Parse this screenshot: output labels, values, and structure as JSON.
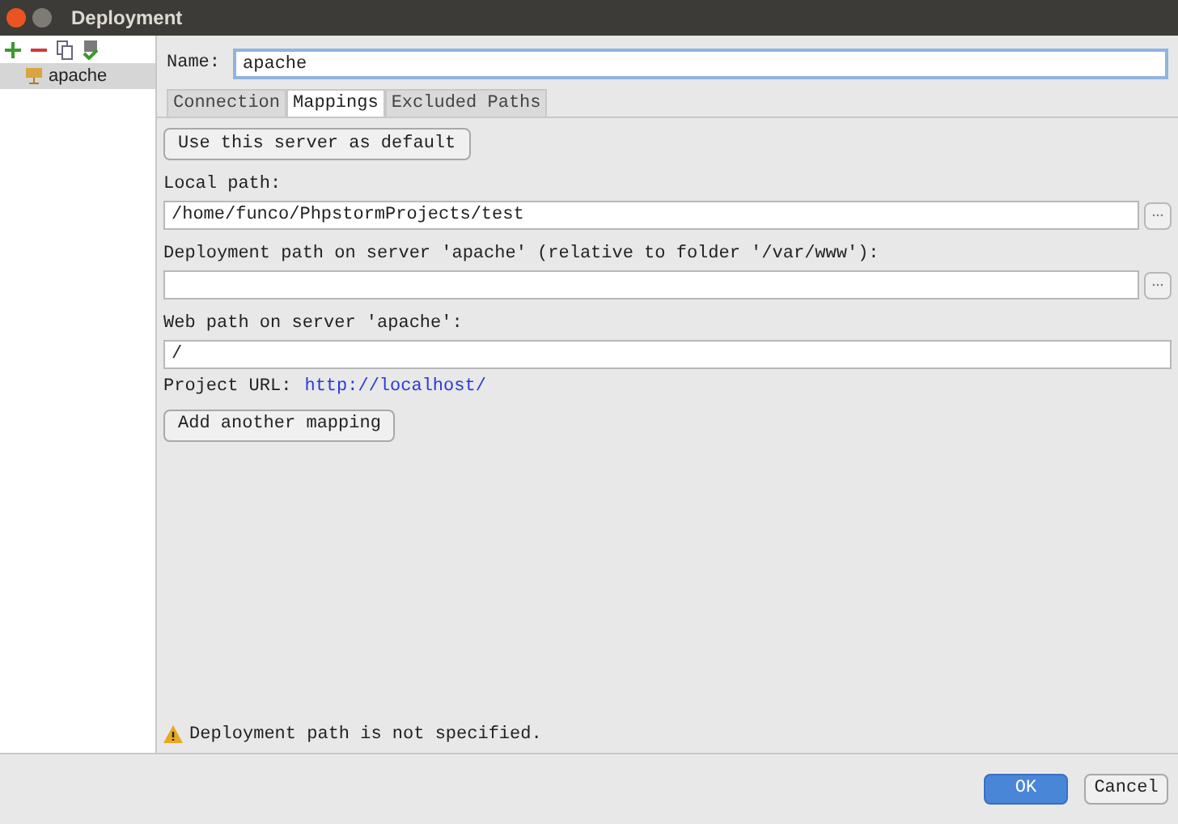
{
  "window": {
    "title": "Deployment"
  },
  "toolbar": {
    "buttons": [
      {
        "kind": "add"
      },
      {
        "kind": "remove"
      },
      {
        "kind": "copy"
      },
      {
        "kind": "default"
      }
    ]
  },
  "sidebar": {
    "items": [
      {
        "label": "apache",
        "selected": true
      }
    ]
  },
  "name_field": {
    "label": "Name:",
    "value": "apache"
  },
  "tabs": [
    {
      "label": "Connection",
      "selected": false
    },
    {
      "label": "Mappings",
      "selected": true
    },
    {
      "label": "Excluded Paths",
      "selected": false
    }
  ],
  "default_button": "Use this server as default",
  "fields": [
    {
      "label": "Local path:",
      "value": "/home/funco/PhpstormProjects/test",
      "browse": true
    },
    {
      "label": "Deployment path on server 'apache' (relative to folder '/var/www'):",
      "browse": true
    },
    {
      "label": "Web path on server 'apache':",
      "value": "/",
      "browse": false
    }
  ],
  "project_url": {
    "label": "Project URL:",
    "link": "http://localhost/"
  },
  "add_mapping_button": "Add another mapping",
  "warning": "Deployment path is not specified.",
  "buttons": [
    {
      "label": "OK",
      "kind": "primary"
    },
    {
      "label": "Cancel",
      "kind": "secondary"
    }
  ]
}
